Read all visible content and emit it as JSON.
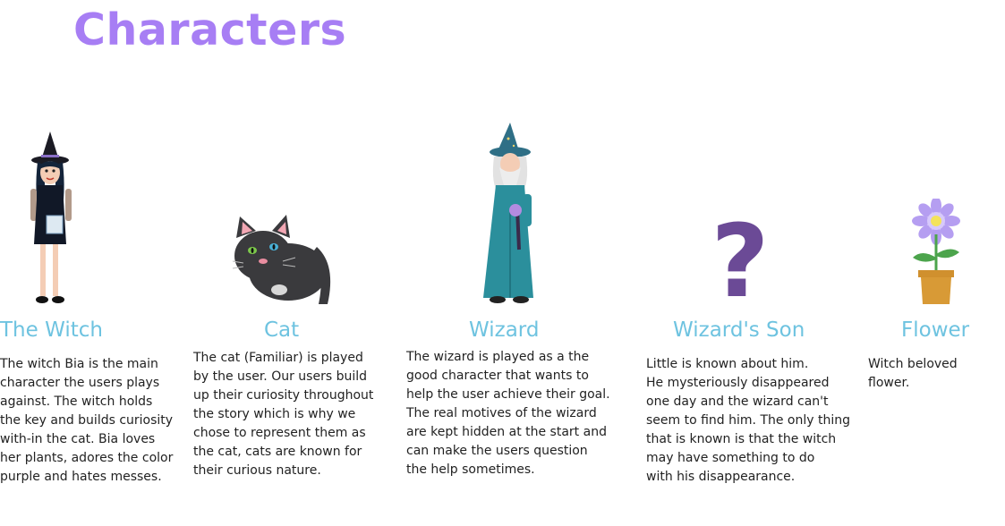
{
  "page": {
    "title": "Characters"
  },
  "colors": {
    "title": "#a77ef4",
    "name": "#6ec3e0",
    "text": "#222222"
  },
  "characters": [
    {
      "name": "The Witch",
      "icon": "witch-illustration",
      "description": "The witch Bia is the main\ncharacter the users plays\nagainst. The witch holds\nthe key and builds curiosity\nwith-in the cat. Bia loves\nher plants, adores the color\npurple and hates messes."
    },
    {
      "name": "Cat",
      "icon": "cat-illustration",
      "description": "The cat (Familiar) is played\nby the user. Our users build\nup their curiosity throughout\nthe story which is why we\nchose to represent them as\nthe cat, cats are known for\ntheir curious nature."
    },
    {
      "name": "Wizard",
      "icon": "wizard-illustration",
      "description": "The wizard is played as a the\ngood character that wants to\nhelp the user achieve their goal.\nThe real motives of the wizard\nare kept hidden at the start and\ncan make the users question\nthe help sometimes."
    },
    {
      "name": "Wizard's Son",
      "icon": "question-mark-icon",
      "description": "Little is known about him.\nHe mysteriously disappeared\none day and the wizard can't\nseem to find him. The only thing\nthat is known is that the witch\nmay have something to do\nwith his disappearance."
    },
    {
      "name": "Flower",
      "icon": "flower-pot-illustration",
      "description": "Witch beloved flower."
    }
  ]
}
